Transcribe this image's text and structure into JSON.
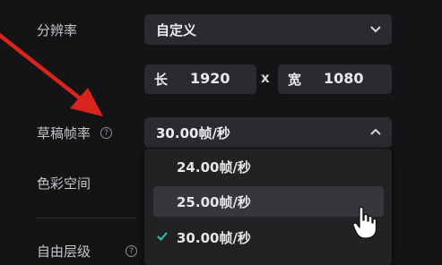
{
  "settings": {
    "resolution_label": "分辨率",
    "resolution_value": "自定义",
    "width_prefix": "长",
    "width_value": "1920",
    "times": "x",
    "height_prefix": "宽",
    "height_value": "1080",
    "framerate_label": "草稿帧率",
    "framerate_value": "30.00帧/秒",
    "color_space_label": "色彩空间",
    "free_layer_label": "自由层级",
    "help_glyph": "?"
  },
  "framerate_menu": {
    "options": [
      {
        "label": "24.00帧/秒",
        "selected": false,
        "hovered": false
      },
      {
        "label": "25.00帧/秒",
        "selected": false,
        "hovered": true
      },
      {
        "label": "30.00帧/秒",
        "selected": true,
        "hovered": false
      }
    ]
  },
  "colors": {
    "arrow": "#d9241d",
    "check": "#2ec4b6",
    "background": "#141416",
    "field": "#2b2b2f"
  },
  "icons": {
    "annotation": "red-arrow-icon",
    "cursor": "hand-pointer-icon"
  }
}
